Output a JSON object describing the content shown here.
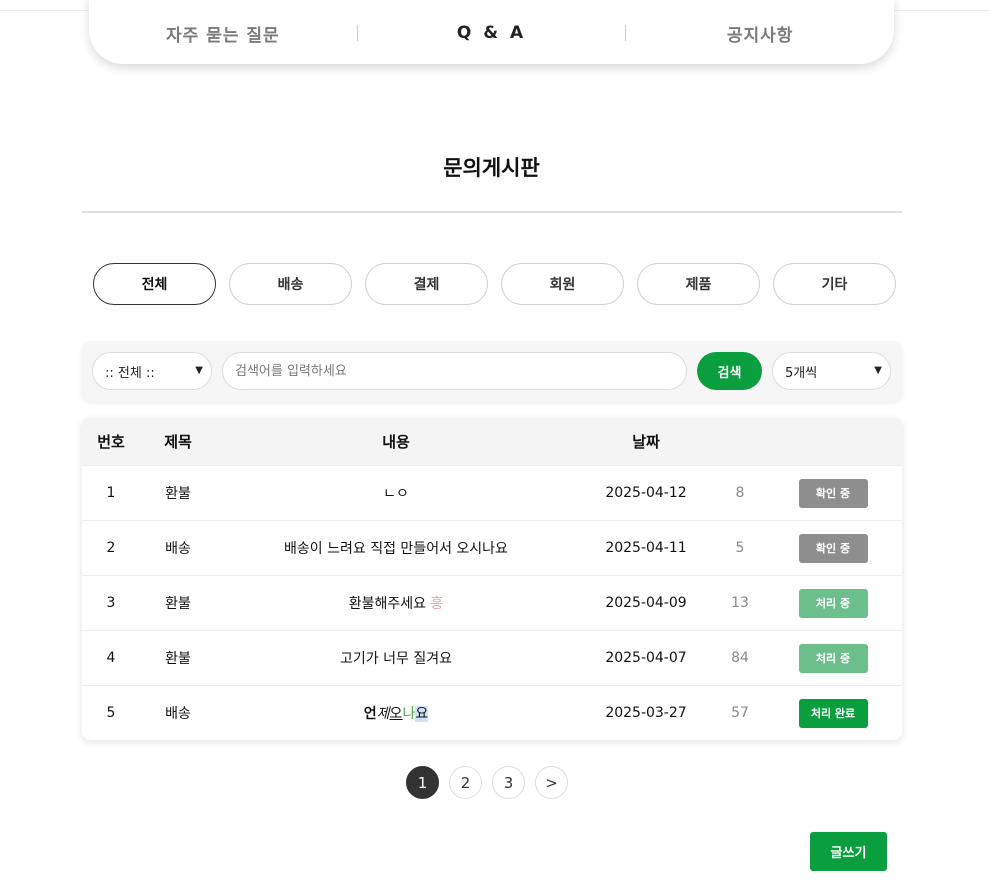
{
  "tabs": [
    {
      "label": "자주 묻는 질문",
      "active": false
    },
    {
      "label": "Q & A",
      "active": true
    },
    {
      "label": "공지사항",
      "active": false
    }
  ],
  "page_title": "문의게시판",
  "categories": [
    {
      "label": "전체",
      "active": true
    },
    {
      "label": "배송",
      "active": false
    },
    {
      "label": "결제",
      "active": false
    },
    {
      "label": "회원",
      "active": false
    },
    {
      "label": "제품",
      "active": false
    },
    {
      "label": "기타",
      "active": false
    }
  ],
  "search": {
    "filter_value": ":: 전체 ::",
    "placeholder": "검색어를 입력하세요",
    "button_label": "검색",
    "page_size_value": "5개씩"
  },
  "table": {
    "headers": {
      "no": "번호",
      "category": "제목",
      "content": "내용",
      "date": "날짜"
    },
    "rows": [
      {
        "no": "1",
        "category": "환불",
        "content": "ㄴㅇ",
        "date": "2025-04-12",
        "views": "8",
        "status": "확인 중",
        "status_color": "#8e8e8e"
      },
      {
        "no": "2",
        "category": "배송",
        "content": "배송이 느려요 직접 만들어서 오시나요",
        "date": "2025-04-11",
        "views": "5",
        "status": "확인 중",
        "status_color": "#8e8e8e"
      },
      {
        "no": "3",
        "category": "환불",
        "content": "환불해주세요 ",
        "content_extra": "흥",
        "date": "2025-04-09",
        "views": "13",
        "status": "처리 중",
        "status_color": "#6cbf8a"
      },
      {
        "no": "4",
        "category": "환불",
        "content": "고기가 너무 질겨요",
        "date": "2025-04-07",
        "views": "84",
        "status": "처리 중",
        "status_color": "#6cbf8a"
      },
      {
        "no": "5",
        "category": "배송",
        "content_parts": [
          "언",
          "제",
          "오",
          "나",
          "요"
        ],
        "date": "2025-03-27",
        "views": "57",
        "status": "처리 완료",
        "status_color": "#0a9e3f"
      }
    ]
  },
  "pagination": {
    "pages": [
      "1",
      "2",
      "3"
    ],
    "next": ">",
    "current": "1"
  },
  "write_button": "글쓰기",
  "colors": {
    "accent": "#0a9e3f",
    "pink_text": "#e8a0a0",
    "green_text": "#4aa84a",
    "highlight": "#cfe3f5"
  }
}
